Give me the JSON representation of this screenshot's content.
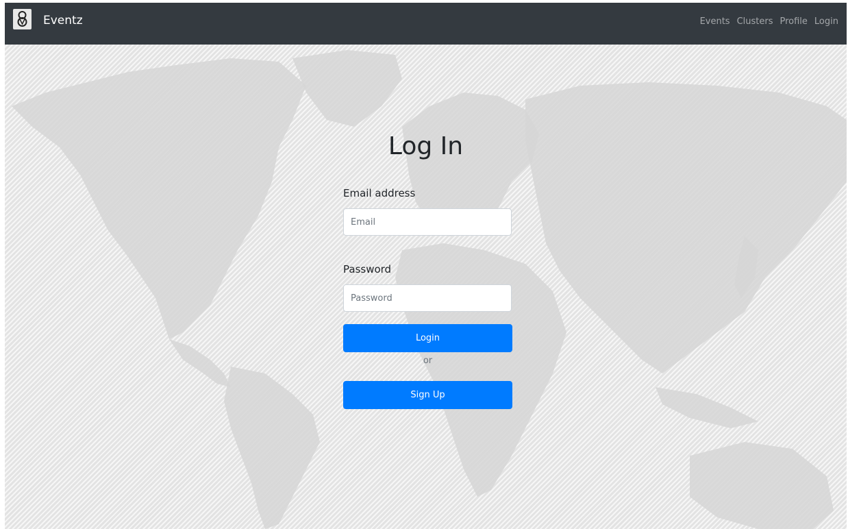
{
  "navbar": {
    "brand": "Eventz",
    "links": [
      "Events",
      "Clusters",
      "Profile",
      "Login"
    ]
  },
  "login_form": {
    "title": "Log In",
    "email_label": "Email address",
    "email_placeholder": "Email",
    "password_label": "Password",
    "password_placeholder": "Password",
    "login_button": "Login",
    "or_text": "or",
    "signup_button": "Sign Up"
  },
  "colors": {
    "navbar_bg": "#343a40",
    "primary_button": "#007bff",
    "background": "#ececec"
  },
  "icons": {
    "brand_logo": "location-pin-logo-icon"
  }
}
